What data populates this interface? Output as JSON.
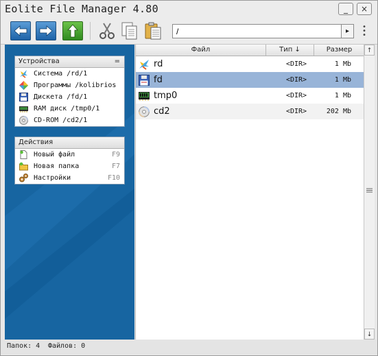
{
  "window": {
    "title": "Eolite File Manager 4.80"
  },
  "titlebar": {
    "minimize_icon": "_",
    "close_icon": "×"
  },
  "toolbar": {
    "path_value": "/",
    "go_icon": "▸",
    "menu_icon": "⋮"
  },
  "devices_panel": {
    "title": "Устройства",
    "toggle": "=",
    "items": [
      {
        "label": "Система /rd/1",
        "icon": "kolibri-bird-icon"
      },
      {
        "label": "Программы /kolibrios",
        "icon": "colored-diamond-icon"
      },
      {
        "label": "Дискета /fd/1",
        "icon": "floppy-disk-icon"
      },
      {
        "label": "RAM диск /tmp0/1",
        "icon": "ram-chip-icon"
      },
      {
        "label": "CD-ROM /cd2/1",
        "icon": "cdrom-icon"
      }
    ]
  },
  "actions_panel": {
    "title": "Действия",
    "items": [
      {
        "label": "Новый файл",
        "key": "F9",
        "icon": "new-file-icon"
      },
      {
        "label": "Новая папка",
        "key": "F7",
        "icon": "new-folder-icon"
      },
      {
        "label": "Настройки",
        "key": "F10",
        "icon": "settings-gears-icon"
      }
    ]
  },
  "files": {
    "headers": {
      "name": "Файл",
      "type": "Тип ↓",
      "size": "Размер"
    },
    "rows": [
      {
        "name": "rd",
        "type": "<DIR>",
        "size": "1 Mb",
        "icon": "kolibri-bird-icon"
      },
      {
        "name": "fd",
        "type": "<DIR>",
        "size": "1 Mb",
        "icon": "floppy-disk-icon"
      },
      {
        "name": "tmp0",
        "type": "<DIR>",
        "size": "1 Mb",
        "icon": "ram-chip-icon"
      },
      {
        "name": "cd2",
        "type": "<DIR>",
        "size": "202 Mb",
        "icon": "cdrom-icon"
      }
    ]
  },
  "scrollbar": {
    "up_icon": "↑",
    "down_icon": "↓",
    "grip_icon": "≡"
  },
  "status": {
    "folders": "Папок: 4",
    "files": "Файлов: 0"
  },
  "colors": {
    "left_pane": "#1765a1",
    "selection": "#98b4d8"
  }
}
